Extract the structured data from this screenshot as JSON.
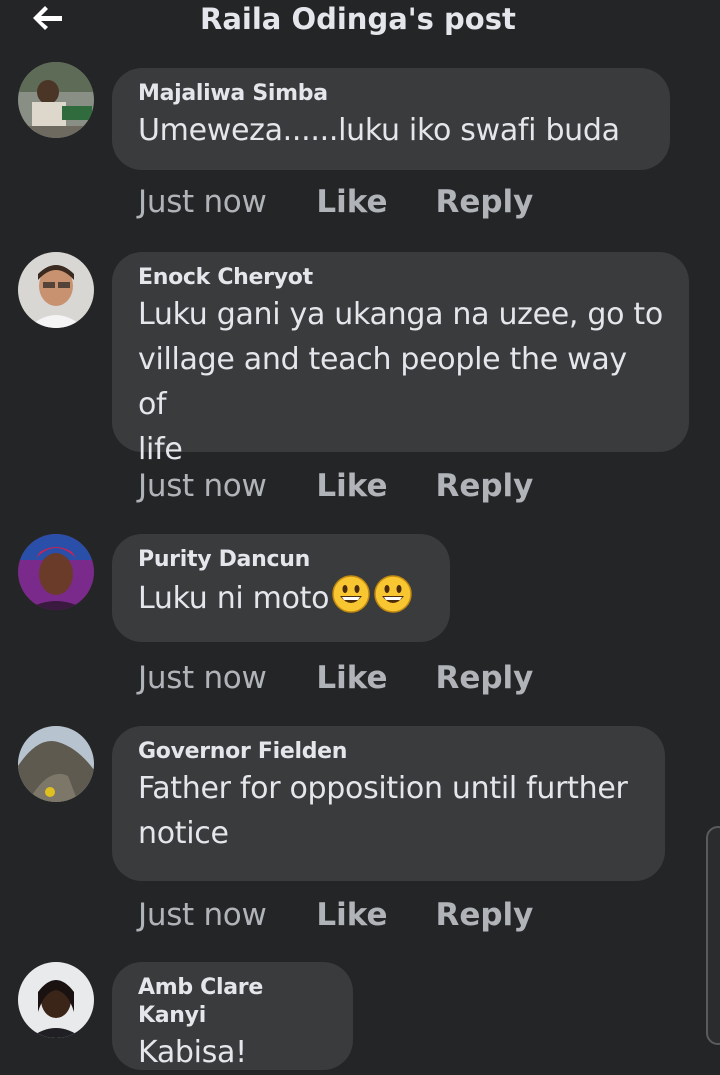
{
  "header": {
    "title": "Raila Odinga's post",
    "back_icon": "back-arrow-icon"
  },
  "comments": [
    {
      "author": "Majaliwa Simba",
      "text": "Umeweza......luku iko swafi buda",
      "timestamp": "Just now",
      "like": "Like",
      "reply": "Reply"
    },
    {
      "author": "Enock Cheryot",
      "text_lines": [
        "Luku gani ya ukanga na uzee, go to",
        "village and teach people the way of",
        "life"
      ],
      "timestamp": "Just now",
      "like": "Like",
      "reply": "Reply"
    },
    {
      "author": "Purity Dancun",
      "text": "Luku ni moto",
      "emojis": [
        "grinning-face-icon",
        "grinning-face-icon"
      ],
      "timestamp": "Just now",
      "like": "Like",
      "reply": "Reply"
    },
    {
      "author": "Governor Fielden",
      "text_lines": [
        "Father for opposition until further",
        "notice"
      ],
      "timestamp": "Just now",
      "like": "Like",
      "reply": "Reply"
    },
    {
      "author": "Amb Clare Kanyi",
      "text": "Kabisa!"
    }
  ],
  "colors": {
    "background": "#242526",
    "bubble": "#3a3b3c",
    "text": "#e4e6eb",
    "muted": "#b0b3b8"
  }
}
